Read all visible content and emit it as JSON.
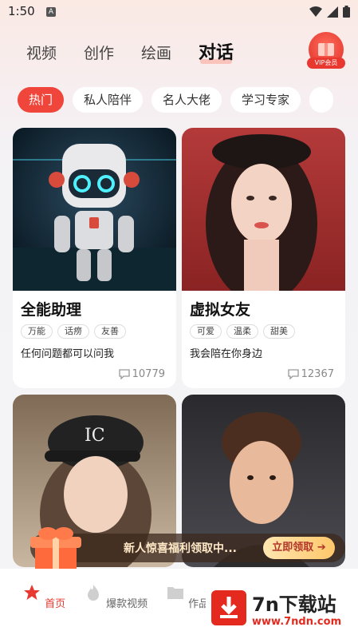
{
  "status_bar": {
    "time": "1:50",
    "notification_badge": "A"
  },
  "top_tabs": [
    {
      "label": "视频",
      "active": false
    },
    {
      "label": "创作",
      "active": false
    },
    {
      "label": "绘画",
      "active": false
    },
    {
      "label": "对话",
      "active": true
    }
  ],
  "vip": {
    "label": "VIP会员"
  },
  "chips": [
    {
      "label": "热门",
      "active": true
    },
    {
      "label": "私人陪伴",
      "active": false
    },
    {
      "label": "名人大佬",
      "active": false
    },
    {
      "label": "学习专家",
      "active": false
    }
  ],
  "cards": [
    {
      "title": "全能助理",
      "tags": [
        "万能",
        "话痨",
        "友善"
      ],
      "desc": "任何问题都可以问我",
      "count": "10779"
    },
    {
      "title": "虚拟女友",
      "tags": [
        "可爱",
        "温柔",
        "甜美"
      ],
      "desc": "我会陪在你身边",
      "count": "12367"
    }
  ],
  "banner": {
    "text": "新人惊喜福利领取中...",
    "button": "立即领取"
  },
  "bottom_nav": [
    {
      "label": "首页",
      "active": true
    },
    {
      "label": "爆款视频",
      "active": false
    },
    {
      "label": "作品",
      "active": false
    }
  ],
  "watermark": {
    "title": "7n下载站",
    "url": "www.7ndn.com"
  },
  "colors": {
    "accent": "#f0453b",
    "brand_red": "#e42a1e"
  }
}
